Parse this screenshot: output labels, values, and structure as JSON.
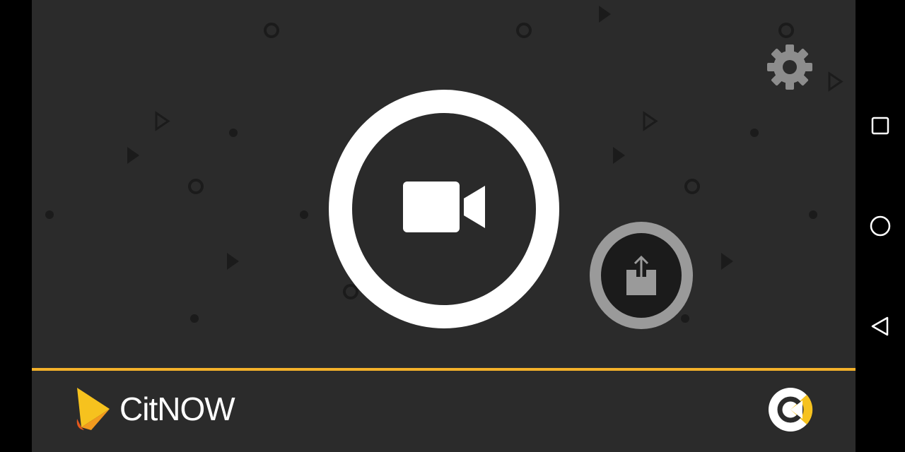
{
  "app": {
    "brand_name": "CitNOW",
    "accent_color": "#f3b12a",
    "background_color": "#2b2b2b",
    "pattern_color": "#1c1c1c"
  },
  "controls": {
    "record_icon": "video-camera-icon",
    "upload_icon": "share-upload-icon",
    "settings_icon": "gear-icon"
  },
  "navigation": {
    "items": [
      {
        "icon": "recents-square-icon"
      },
      {
        "icon": "home-circle-icon"
      },
      {
        "icon": "back-triangle-icon"
      }
    ]
  }
}
